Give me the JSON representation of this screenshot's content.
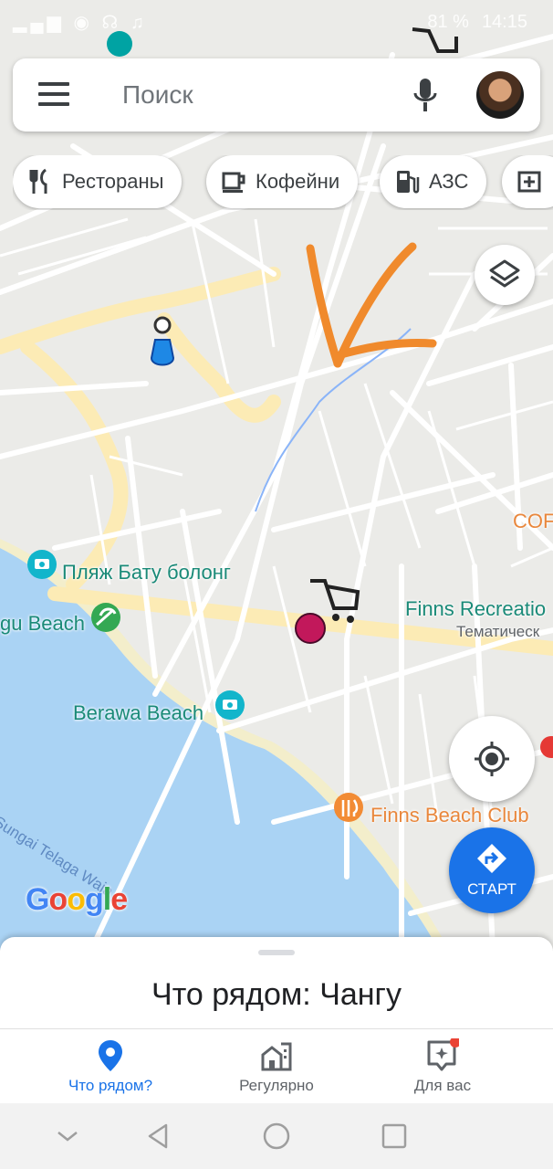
{
  "status_bar": {
    "left_icons": "▂▄▆ ◉ ☊ ♫",
    "battery": "81 %",
    "time": "14:15"
  },
  "search": {
    "placeholder": "Поиск",
    "menu_icon": "menu-icon",
    "mic_icon": "microphone-icon"
  },
  "chips": [
    {
      "label": "Рестораны",
      "icon": "fork-knife-icon"
    },
    {
      "label": "Кофейни",
      "icon": "coffee-cup-icon"
    },
    {
      "label": "АЗС",
      "icon": "gas-pump-icon"
    }
  ],
  "map": {
    "labels": {
      "batu_bolong": "Пляж Бату болонг",
      "canggu_beach": "gu Beach",
      "berawa_beach": "Berawa Beach",
      "finns_recreation": "Finns Recreatio",
      "finns_recreation_sub": "Тематическ",
      "finns_beach_club": "Finns Beach Club",
      "cof": "COF",
      "river": "Sungai Telaga Waja"
    },
    "logo": "Google",
    "colors": {
      "water": "#aad3f4",
      "road": "#ffffff",
      "major_road": "#fcebb5",
      "land": "#ebebe8",
      "annotation": "#f08a2c"
    }
  },
  "start_button": {
    "label": "СТАРТ"
  },
  "sheet": {
    "title": "Что рядом: Чангу"
  },
  "bottom_nav": [
    {
      "label": "Что рядом?",
      "active": true
    },
    {
      "label": "Регулярно",
      "active": false
    },
    {
      "label": "Для вас",
      "active": false
    }
  ],
  "accent_color": "#1a73e8"
}
